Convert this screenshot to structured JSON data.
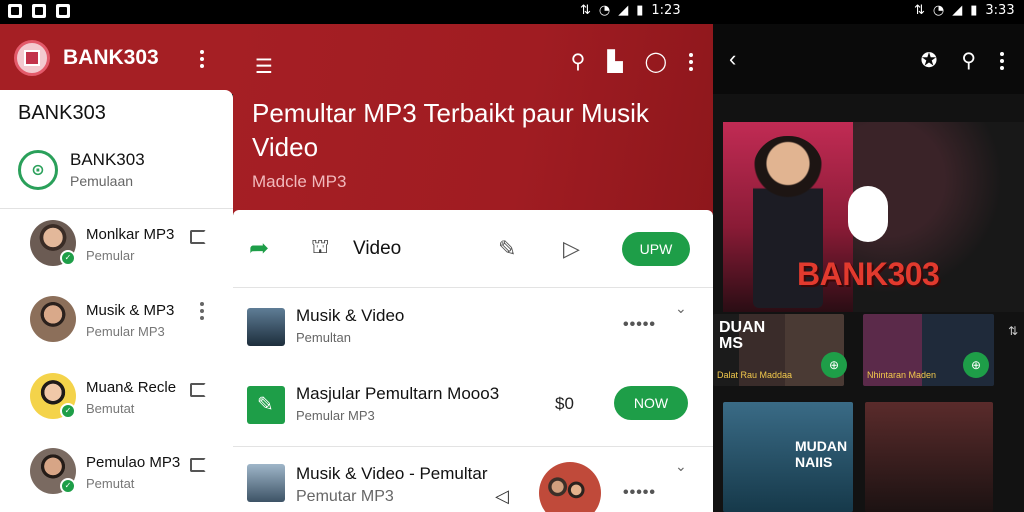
{
  "status_bar": {
    "left_time": "1:23",
    "right_time": "3:33"
  },
  "drawer_app": {
    "title": "BANK303",
    "drawer_title": "BANK303",
    "account": {
      "name": "BANK303",
      "subtitle": "Pemulaan"
    },
    "items": [
      {
        "label": "Monlkar MP3",
        "sub": "Pemular"
      },
      {
        "label": "Musik & MP3",
        "sub": "Pemular MP3"
      },
      {
        "label": "Muan& Recle",
        "sub": "Bemutat"
      },
      {
        "label": "Pemulao MP3",
        "sub": "Pemutat"
      }
    ]
  },
  "middle": {
    "header_title": "Pemultar MP3 Terbaikt paur Musik Video",
    "header_subtitle": "Madcle MP3",
    "toolbar": {
      "video_label": "Video",
      "upw_label": "UPW"
    },
    "rows": [
      {
        "title": "Musik & Video",
        "sub": "Pemultan",
        "dots": "•••••"
      },
      {
        "title": "Masjular Pemultarn Mooo3",
        "sub": "Pemular MP3",
        "price": "$0",
        "button": "NOW"
      },
      {
        "title": "Musik & Video - Pemultar",
        "sub": "Pemutar MP3",
        "dots": "•••••"
      }
    ]
  },
  "right": {
    "hero_brand": "BANK303",
    "card1_text": "DUAN\nMS",
    "card1_caption": "Dalat Rau Maddaa",
    "card2_caption": "Nhintaran Maden",
    "card3_text": "MUDAN\nNAIIS"
  },
  "colors": {
    "brand_red": "#a51f24",
    "accent_green": "#1e9e48",
    "hero_text_red": "#e23a2e"
  }
}
